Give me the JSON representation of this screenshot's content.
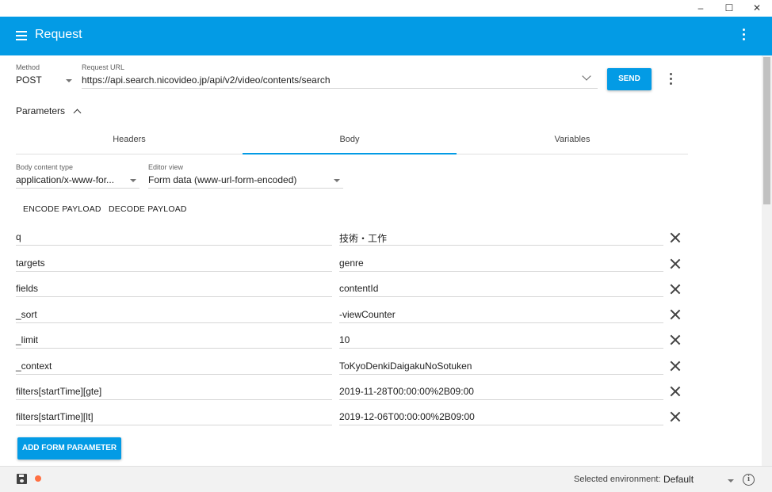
{
  "window": {
    "minimize": "–",
    "maximize": "☐",
    "close": "✕"
  },
  "appbar": {
    "title": "Request",
    "menu_icon": "hamburger-icon",
    "more_icon": "more-vert-icon"
  },
  "request": {
    "method_label": "Method",
    "method_value": "POST",
    "url_label": "Request URL",
    "url_value": "https://api.search.nicovideo.jp/api/v2/video/contents/search",
    "send_label": "SEND"
  },
  "parameters": {
    "label": "Parameters"
  },
  "tabs": [
    {
      "label": "Headers"
    },
    {
      "label": "Body",
      "active": true
    },
    {
      "label": "Variables"
    }
  ],
  "body": {
    "content_type_label": "Body content type",
    "content_type_value": "application/x-www-for...",
    "editor_view_label": "Editor view",
    "editor_view_value": "Form data (www-url-form-encoded)",
    "encode_label": "ENCODE PAYLOAD",
    "decode_label": "DECODE PAYLOAD"
  },
  "form_rows": [
    {
      "name": "q",
      "value": "技術・工作"
    },
    {
      "name": "targets",
      "value": "genre"
    },
    {
      "name": "fields",
      "value": "contentId"
    },
    {
      "name": "_sort",
      "value": "-viewCounter"
    },
    {
      "name": "_limit",
      "value": "10"
    },
    {
      "name": "_context",
      "value": "ToKyoDenkiDaigakuNoSotuken"
    },
    {
      "name": "filters[startTime][gte]",
      "value": "2019-11-28T00:00:00%2B09:00"
    },
    {
      "name": "filters[startTime][lt]",
      "value": "2019-12-06T00:00:00%2B09:00"
    }
  ],
  "add_param_label": "ADD FORM PARAMETER",
  "statusbar": {
    "env_label": "Selected environment:",
    "env_value": "Default",
    "info_glyph": "i"
  },
  "colors": {
    "accent": "#039be5",
    "status_dot": "#ff7043"
  }
}
